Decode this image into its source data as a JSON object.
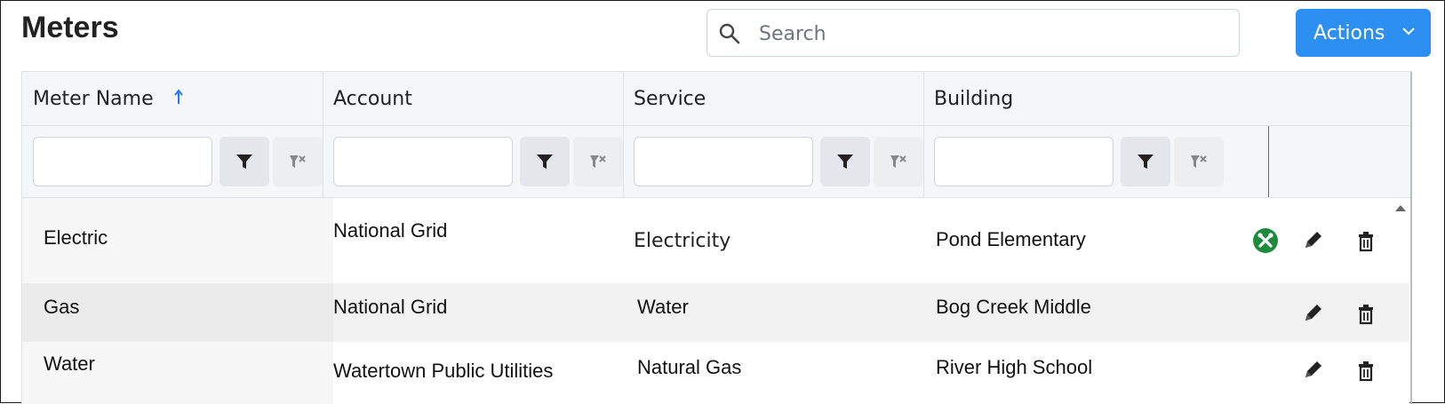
{
  "page": {
    "title": "Meters"
  },
  "search": {
    "placeholder": "Search",
    "value": ""
  },
  "actions": {
    "label": "Actions"
  },
  "columns": [
    {
      "label": "Meter Name",
      "sorted": "ascending"
    },
    {
      "label": "Account"
    },
    {
      "label": "Service"
    },
    {
      "label": "Building"
    }
  ],
  "filters": [
    {
      "value": ""
    },
    {
      "value": ""
    },
    {
      "value": ""
    },
    {
      "value": ""
    }
  ],
  "rows": [
    {
      "meter": "Electric",
      "account": "National Grid",
      "service": "Electricity",
      "building": "Pond Elementary",
      "has_tools_badge": true
    },
    {
      "meter": "Gas",
      "account": "National Grid",
      "service": "Water",
      "building": "Bog Creek Middle",
      "has_tools_badge": false
    },
    {
      "meter": "Water",
      "account": "Watertown Public Utilities",
      "service": "Natural Gas",
      "building": "River High School",
      "has_tools_badge": false
    }
  ],
  "icons": {
    "search": "search-icon",
    "dropdown": "chevron-down-icon",
    "sort": "sort-ascending-arrow-icon",
    "filter": "filter-icon",
    "clear_filter": "clear-filter-icon",
    "tools": "tools-icon",
    "edit": "pencil-icon",
    "delete": "trash-icon",
    "scroll_up": "scroll-up-arrow-icon"
  },
  "colors": {
    "primary": "#2d8ff2",
    "tools_badge": "#1e8a3c",
    "header_bg": "#f5f6f7",
    "stripe_bg": "#f2f2f2"
  }
}
